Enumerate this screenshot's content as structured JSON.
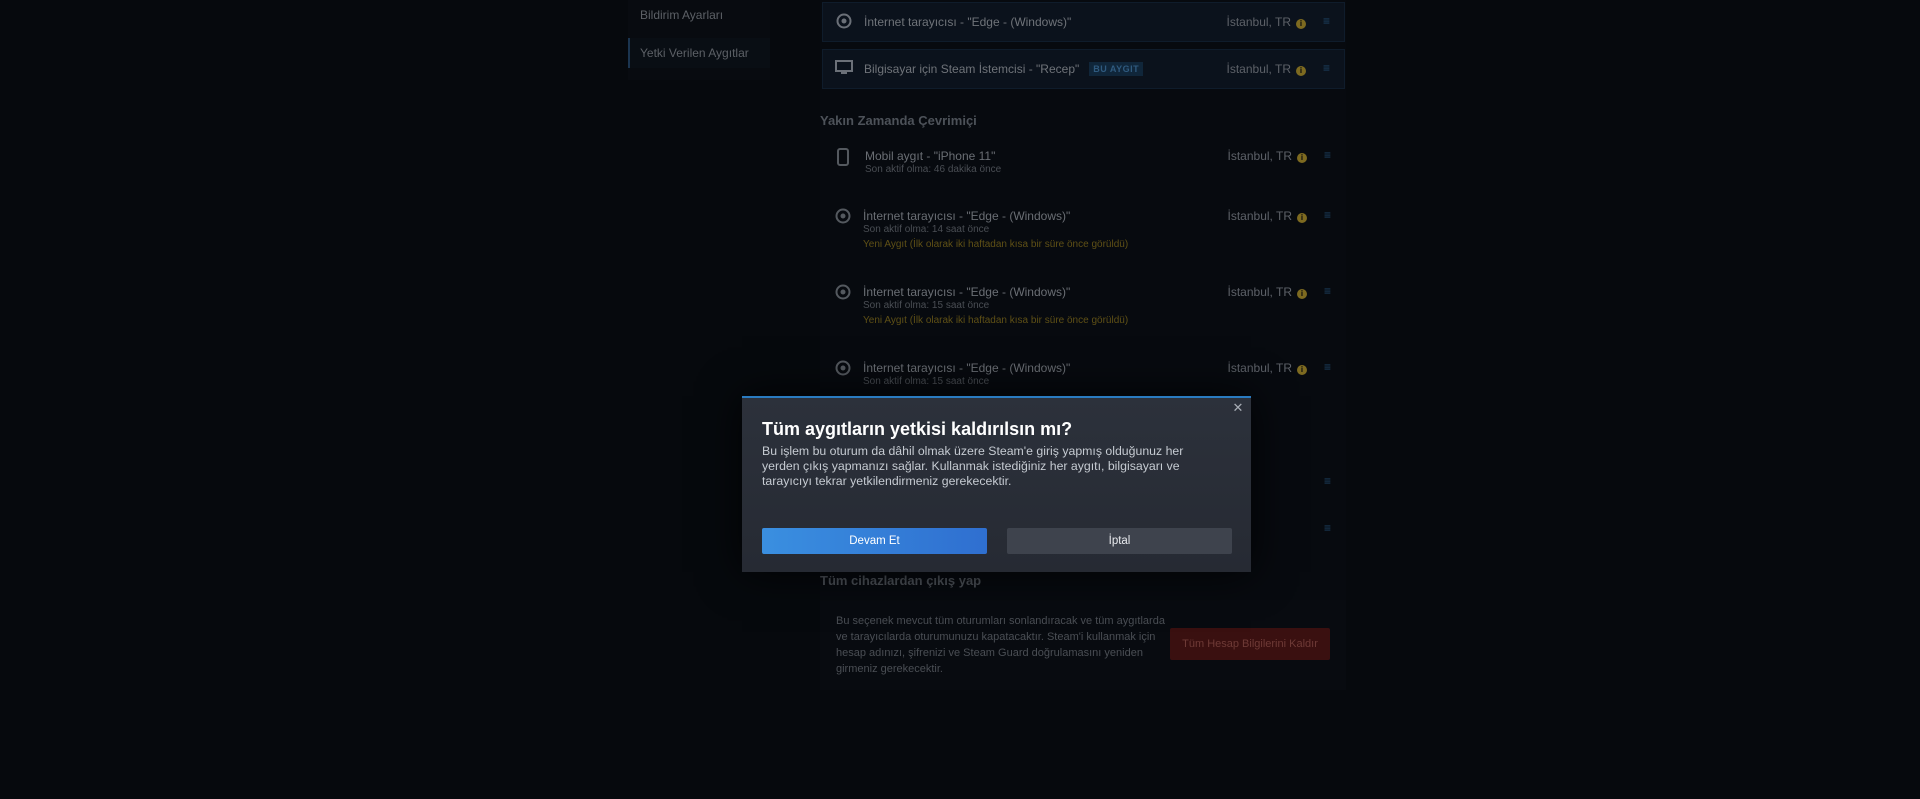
{
  "sidebar": {
    "items": [
      {
        "label": "Bildirim Ayarları"
      },
      {
        "label": "Yetki Verilen Aygıtlar"
      }
    ]
  },
  "active_devices": [
    {
      "name": "İnternet tarayıcısı - \"Edge - (Windows)\"",
      "location": "İstanbul, TR",
      "icon": "browser-icon"
    },
    {
      "name": "Bilgisayar için Steam İstemcisi - \"Recep\"",
      "badge": "BU AYGIT",
      "location": "İstanbul, TR",
      "icon": "monitor-icon"
    }
  ],
  "recent": {
    "title": "Yakın Zamanda Çevrimiçi",
    "devices": [
      {
        "name": "Mobil aygıt - \"iPhone 11\"",
        "last_seen": "Son aktif olma: 46 dakika önce",
        "location": "İstanbul, TR",
        "icon": "phone-icon"
      },
      {
        "name": "İnternet tarayıcısı - \"Edge - (Windows)\"",
        "last_seen": "Son aktif olma: 14 saat önce",
        "warning": "Yeni Aygıt (İlk olarak iki haftadan kısa bir süre önce görüldü)",
        "location": "İstanbul, TR",
        "icon": "browser-icon"
      },
      {
        "name": "İnternet tarayıcısı - \"Edge - (Windows)\"",
        "last_seen": "Son aktif olma: 15 saat önce",
        "warning": "Yeni Aygıt (İlk olarak iki haftadan kısa bir süre önce görüldü)",
        "location": "İstanbul, TR",
        "icon": "browser-icon"
      },
      {
        "name": "İnternet tarayıcısı - \"Edge - (Windows)\"",
        "last_seen": "Son aktif olma: 15 saat önce",
        "location": "İstanbul, TR",
        "icon": "browser-icon"
      }
    ]
  },
  "logout_all": {
    "title": "Tüm cihazlardan çıkış yap",
    "description": "Bu seçenek mevcut tüm oturumları sonlandıracak ve tüm aygıtlarda ve tarayıcılarda oturumunuzu kapatacaktır. Steam'i kullanmak için hesap adınızı, şifrenizi ve Steam Guard doğrulamasını yeniden girmeniz gerekecektir.",
    "button": "Tüm Hesap Bilgilerini Kaldır"
  },
  "modal": {
    "title": "Tüm aygıtların yetkisi kaldırılsın mı?",
    "body": "Bu işlem bu oturum da dâhil olmak üzere Steam'e giriş yapmış olduğunuz her yerden çıkış yapmanızı sağlar. Kullanmak istediğiniz her aygıtı, bilgisayarı ve tarayıcıyı tekrar yetkilendirmeniz gerekecektir.",
    "confirm": "Devam Et",
    "cancel": "İptal",
    "close_icon": "close-icon"
  },
  "colors": {
    "accent": "#2a7bc0",
    "primary_button": "#3a8fe0",
    "background": "#06090d"
  }
}
